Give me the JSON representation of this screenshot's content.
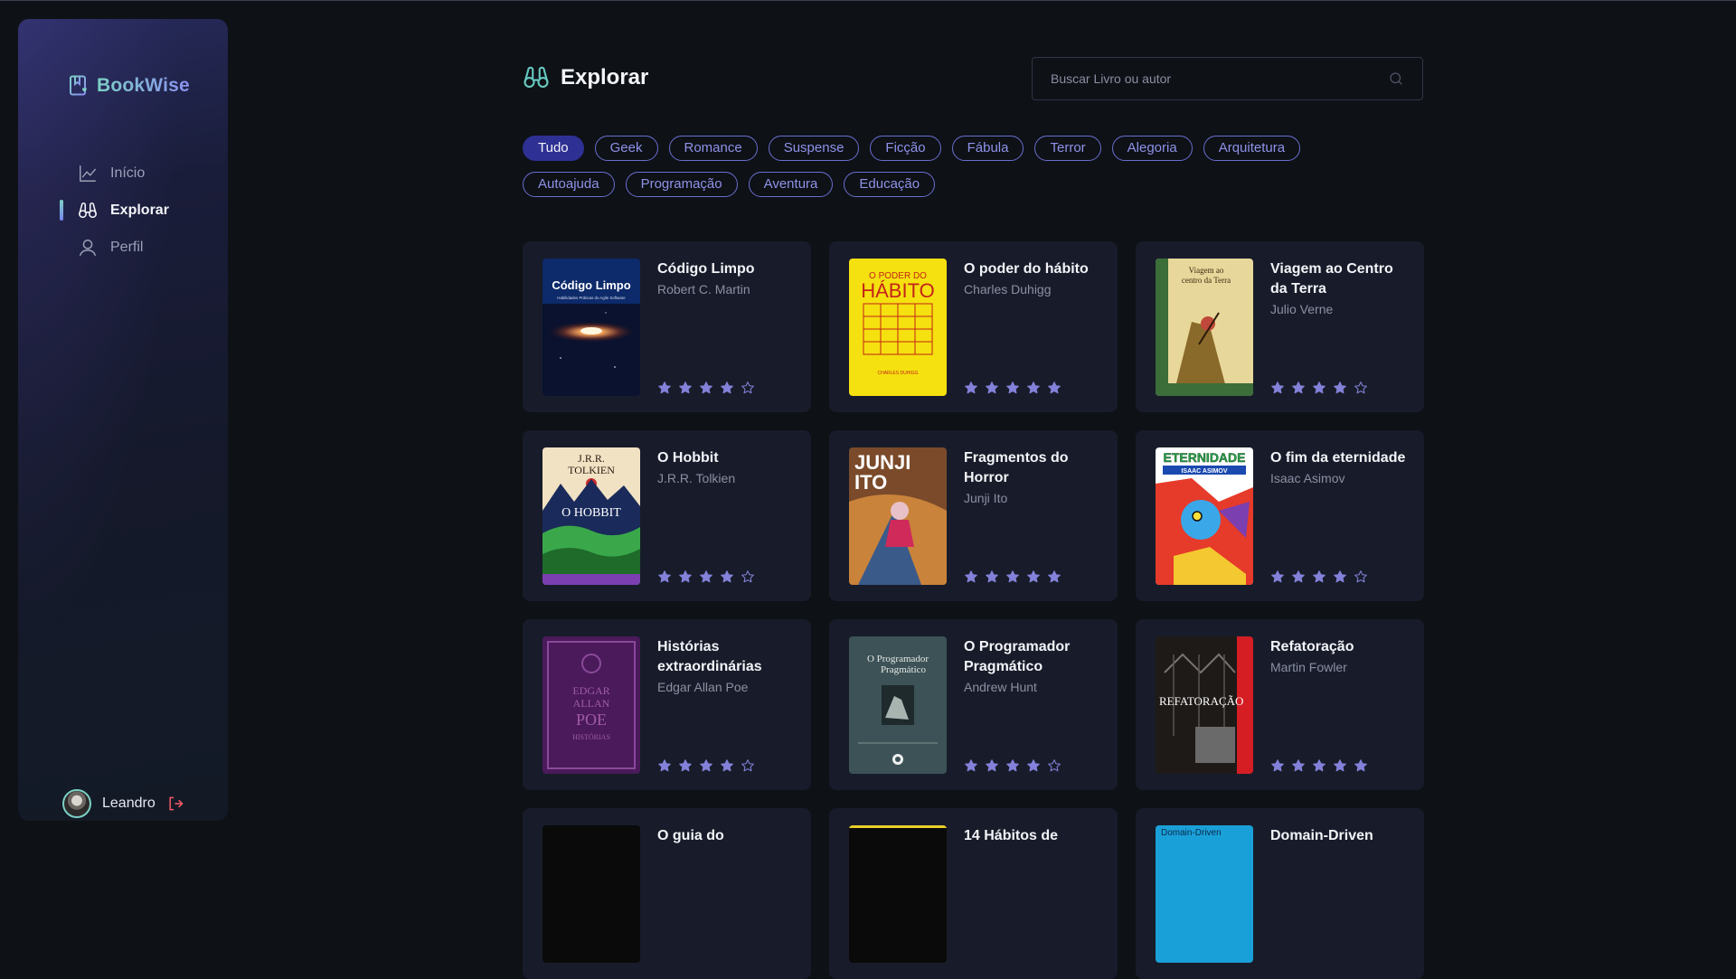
{
  "app": {
    "name": "BookWise"
  },
  "sidebar": {
    "items": [
      {
        "label": "Início",
        "icon": "chart-line-icon",
        "active": false
      },
      {
        "label": "Explorar",
        "icon": "binoculars-icon",
        "active": true
      },
      {
        "label": "Perfil",
        "icon": "user-icon",
        "active": false
      }
    ],
    "user": {
      "name": "Leandro"
    }
  },
  "page": {
    "title": "Explorar"
  },
  "search": {
    "placeholder": "Buscar Livro ou autor",
    "value": ""
  },
  "tags": [
    {
      "label": "Tudo",
      "active": true
    },
    {
      "label": "Geek",
      "active": false
    },
    {
      "label": "Romance",
      "active": false
    },
    {
      "label": "Suspense",
      "active": false
    },
    {
      "label": "Ficção",
      "active": false
    },
    {
      "label": "Fábula",
      "active": false
    },
    {
      "label": "Terror",
      "active": false
    },
    {
      "label": "Alegoria",
      "active": false
    },
    {
      "label": "Arquitetura",
      "active": false
    },
    {
      "label": "Autoajuda",
      "active": false
    },
    {
      "label": "Programação",
      "active": false
    },
    {
      "label": "Aventura",
      "active": false
    },
    {
      "label": "Educação",
      "active": false
    }
  ],
  "books": [
    {
      "title": "Código Limpo",
      "author": "Robert C. Martin",
      "rating": 4,
      "cover_text": [
        "Código Limpo",
        "Habilidades Práticas do Agile Software"
      ]
    },
    {
      "title": "O poder do hábito",
      "author": "Charles Duhigg",
      "rating": 5,
      "cover_text": [
        "O PODER DO",
        "HÁBITO",
        "CHARLES DUHIGG"
      ]
    },
    {
      "title": "Viagem ao Centro da Terra",
      "author": "Julio Verne",
      "rating": 4,
      "cover_text": [
        "Viagem ao",
        "centro da Terra"
      ]
    },
    {
      "title": "O Hobbit",
      "author": "J.R.R. Tolkien",
      "rating": 4,
      "cover_text": [
        "J.R.R.",
        "TOLKIEN",
        "O HOBBIT"
      ]
    },
    {
      "title": "Fragmentos do Horror",
      "author": "Junji Ito",
      "rating": 5,
      "cover_text": [
        "JUNJI",
        "ITO"
      ]
    },
    {
      "title": "O fim da eternidade",
      "author": "Isaac Asimov",
      "rating": 4,
      "cover_text": [
        "ETERNIDADE",
        "ISAAC ASIMOV"
      ]
    },
    {
      "title": "Histórias extraordinárias",
      "author": "Edgar Allan Poe",
      "rating": 4,
      "cover_text": [
        "EDGAR",
        "ALLAN",
        "POE",
        "HISTÓRIAS"
      ]
    },
    {
      "title": "O Programador Pragmático",
      "author": "Andrew Hunt",
      "rating": 4,
      "cover_text": [
        "O Programador",
        "Pragmático"
      ]
    },
    {
      "title": "Refatoração",
      "author": "Martin Fowler",
      "rating": 5,
      "cover_text": [
        "REFATORAÇÃO"
      ]
    },
    {
      "title": "O guia do",
      "author": "",
      "rating": 0,
      "cover_text": []
    },
    {
      "title": "14 Hábitos de",
      "author": "",
      "rating": 0,
      "cover_text": []
    },
    {
      "title": "Domain-Driven",
      "author": "",
      "rating": 0,
      "cover_text": [
        "Domain-Driven"
      ]
    }
  ],
  "colors": {
    "accent": "#8381d9",
    "tag_active": "#2e3093",
    "card_bg": "#181c2a",
    "logout": "#f75a68"
  }
}
